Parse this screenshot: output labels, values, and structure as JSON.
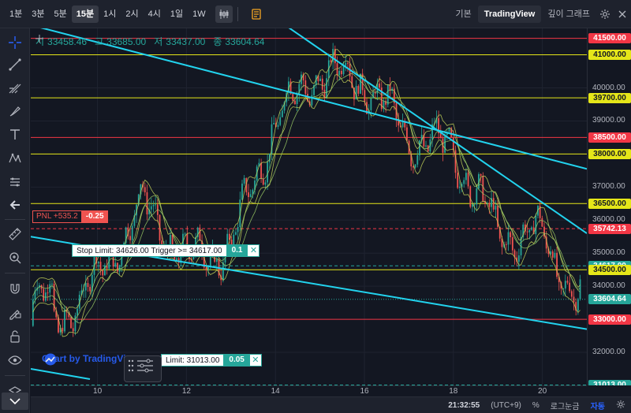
{
  "toolbar": {
    "timeframes": [
      "1분",
      "3분",
      "5분",
      "15분",
      "1시",
      "2시",
      "4시",
      "1일",
      "1W"
    ],
    "active_timeframe": "15분",
    "chart_type_icon": "candles-icon",
    "indicator_icon": "indicator-icon"
  },
  "right_tabs": {
    "basic": "기본",
    "tradingview": "TradingView",
    "depth": "깊이 그래프",
    "settings_icon": "settings-icon",
    "close_icon": "close-icon"
  },
  "left_tools": [
    "crosshair-icon",
    "trendline-icon",
    "fib-icon",
    "brush-icon",
    "text-icon",
    "pattern-icon",
    "prediction-icon",
    "back-arrow-icon",
    "ruler-icon",
    "zoom-icon",
    "magnet-icon",
    "lock-drawing-icon",
    "lock-icon",
    "eye-icon",
    "layers-icon",
    "collapse-icon"
  ],
  "ohlc": {
    "open_key": "시",
    "open": "33458.46",
    "high_key": "고",
    "high": "33685.00",
    "low_key": "저",
    "low": "33437.00",
    "close_key": "종",
    "close": "33604.64"
  },
  "price_ticks": [
    "40000.00",
    "39000.00",
    "37000.00",
    "36000.00",
    "35000.00",
    "34000.00",
    "32000.00"
  ],
  "levels": [
    {
      "price": "41500.00",
      "color": "#f23645"
    },
    {
      "price": "41000.00",
      "color": "#e5e619"
    },
    {
      "price": "39700.00",
      "color": "#e5e619"
    },
    {
      "price": "38500.00",
      "color": "#f23645"
    },
    {
      "price": "38000.00",
      "color": "#e5e619"
    },
    {
      "price": "36500.00",
      "color": "#e5e619"
    },
    {
      "price": "35742.13",
      "color": "#f23645"
    },
    {
      "price": "34617.00",
      "color": "#26a69a"
    },
    {
      "price": "34500.00",
      "color": "#e5e619"
    },
    {
      "price": "33604.64",
      "color": "#26a69a"
    },
    {
      "price": "33000.00",
      "color": "#f23645"
    },
    {
      "price": "31013.00",
      "color": "#26a69a"
    }
  ],
  "time_ticks": [
    "10",
    "12",
    "14",
    "16",
    "18",
    "20"
  ],
  "orders": {
    "stop": {
      "label": "Stop Limit: 34626.00 Trigger >= 34617.00",
      "qty": "0.1",
      "close": "✕"
    },
    "limit": {
      "label": "Limit: 31013.00",
      "qty": "0.05",
      "close": "✕"
    }
  },
  "position": {
    "pnl": "PNL +535.2",
    "qty": "-0.25"
  },
  "watermark": "Chart by TradingView",
  "bottom": {
    "clock": "21:32:55",
    "tz": "(UTC+9)",
    "percent": "%",
    "log": "로그눈금",
    "auto": "자동",
    "settings_icon": "settings-icon"
  },
  "colors": {
    "up": "#26a69a",
    "down": "#ef5350",
    "trendline": "#22d3ee",
    "ribbon": "#c9d95a"
  },
  "chart_data": {
    "type": "line",
    "x_axis": [
      "9",
      "10",
      "11",
      "12",
      "13",
      "14",
      "15",
      "16",
      "17",
      "18",
      "19",
      "20",
      "20.8"
    ],
    "series": [
      {
        "values": [
          32800,
          34200,
          36500,
          34800,
          35200,
          39000,
          40500,
          40200,
          38500,
          38100,
          35600,
          35500,
          33600
        ]
      }
    ],
    "ylim": [
      31000,
      41800
    ],
    "trendlines": [
      {
        "from": [
          8.5,
          41900
        ],
        "to": [
          21.0,
          37550
        ]
      },
      {
        "from": [
          8.5,
          35500
        ],
        "to": [
          21.0,
          32700
        ]
      },
      {
        "from": [
          14.0,
          42100
        ],
        "to": [
          21.0,
          35600
        ]
      }
    ]
  }
}
